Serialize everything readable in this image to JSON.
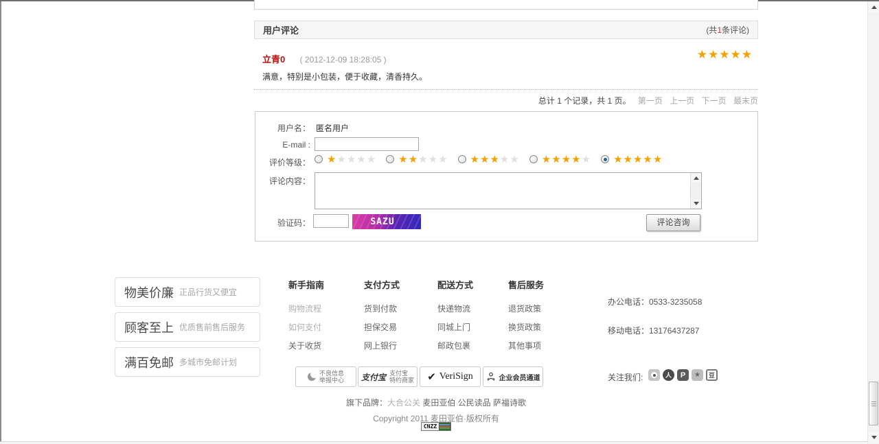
{
  "comments": {
    "title": "用户评论",
    "count_pre": "(共",
    "count_num": "1",
    "count_post": "条评论)",
    "review": {
      "author": "立青0",
      "date": "( 2012-12-09 18:28:05 )",
      "text": "满意，特别是小包装，便于收藏，清香持久。",
      "rating": 5
    },
    "pagination": {
      "summary": "总计 1 个记录，共 1 页。",
      "first": "第一页",
      "prev": "上一页",
      "next": "下一页",
      "last": "最末页"
    }
  },
  "form": {
    "username_label": "用户名：",
    "username_value": "匿名用户",
    "email_label": "E-mail :",
    "rating_label": "评价等级：",
    "rating_selected": 5,
    "content_label": "评论内容：",
    "captcha_label": "验证码：",
    "captcha_code": "SAZU",
    "submit": "评论咨询"
  },
  "footer": {
    "features": [
      {
        "title": "物美价廉",
        "subtitle": "正品行货又便宜"
      },
      {
        "title": "顾客至上",
        "subtitle": "优质售前售后服务"
      },
      {
        "title": "满百免邮",
        "subtitle": "多城市免邮计划"
      }
    ],
    "columns": [
      {
        "title": "新手指南",
        "items": [
          "购物流程",
          "如何支付",
          "关于收货"
        ]
      },
      {
        "title": "支付方式",
        "items": [
          "货到付款",
          "担保交易",
          "网上银行"
        ]
      },
      {
        "title": "配送方式",
        "items": [
          "快递物流",
          "同城上门",
          "邮政包裹"
        ]
      },
      {
        "title": "售后服务",
        "items": [
          "退货政策",
          "换货政策",
          "其他事项"
        ]
      }
    ],
    "phone_office": "办公电话：0533-3235058",
    "phone_mobile": "移动电话：13176437287",
    "badges": {
      "report_line1": "不良信息",
      "report_line2": "举报中心",
      "alipay_logo": "支付宝",
      "alipay_line1": "支付宝",
      "alipay_line2": "特约商家",
      "verisign": "VeriSign",
      "member": "企业会员通道"
    },
    "follow": "关注我们:",
    "brands_label": "旗下品牌：",
    "brand_muted": "大合公关",
    "brands_rest": "麦田亚伯 公民读品 萨福诗歌",
    "copyright": "Copyright 2011 麦田亚伯·版权所有",
    "cnzz": "CNZZ"
  },
  "icons": {
    "check": "✔",
    "renren": "人",
    "pengyou": "P",
    "qzone": "★",
    "douban": "豆"
  },
  "colors": {
    "star_on": "#F5A100",
    "star_off": "#E0E0E0",
    "author_red": "#BB1111",
    "count_red": "#D03030",
    "link_gray": "#A8A8A8"
  }
}
